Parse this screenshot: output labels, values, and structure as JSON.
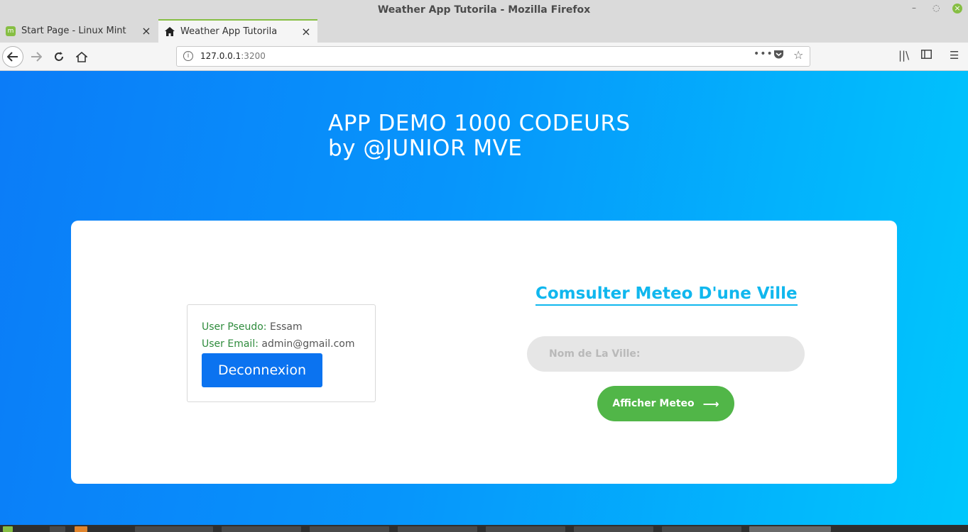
{
  "window": {
    "title": "Weather App Tutorila - Mozilla Firefox"
  },
  "tabs": [
    {
      "label": "Start Page - Linux Mint",
      "icon": "linux-mint-icon",
      "active": false
    },
    {
      "label": "Weather App Tutorila",
      "icon": "home-icon",
      "active": true
    }
  ],
  "navbar": {
    "url_host": "127.0.0.1",
    "url_port": ":3200"
  },
  "page": {
    "hero_line1": "APP DEMO 1000 CODEURS",
    "hero_line2": "by @JUNIOR MVE",
    "user": {
      "pseudo_label": "User Pseudo:",
      "pseudo_value": "Essam",
      "email_label": "User Email:",
      "email_value": "admin@gmail.com",
      "logout_label": "Deconnexion"
    },
    "weather": {
      "title": "Comsulter Meteo D'une Ville",
      "city_placeholder": "Nom de La Ville:",
      "show_label": "Afficher Meteo"
    }
  },
  "colors": {
    "gradient_start": "#0b7cf8",
    "gradient_end": "#00c7fc",
    "accent_blue": "#10b7ee",
    "logout_button": "#0b73f0",
    "show_button": "#51b648",
    "label_green": "#2e8b3c"
  }
}
